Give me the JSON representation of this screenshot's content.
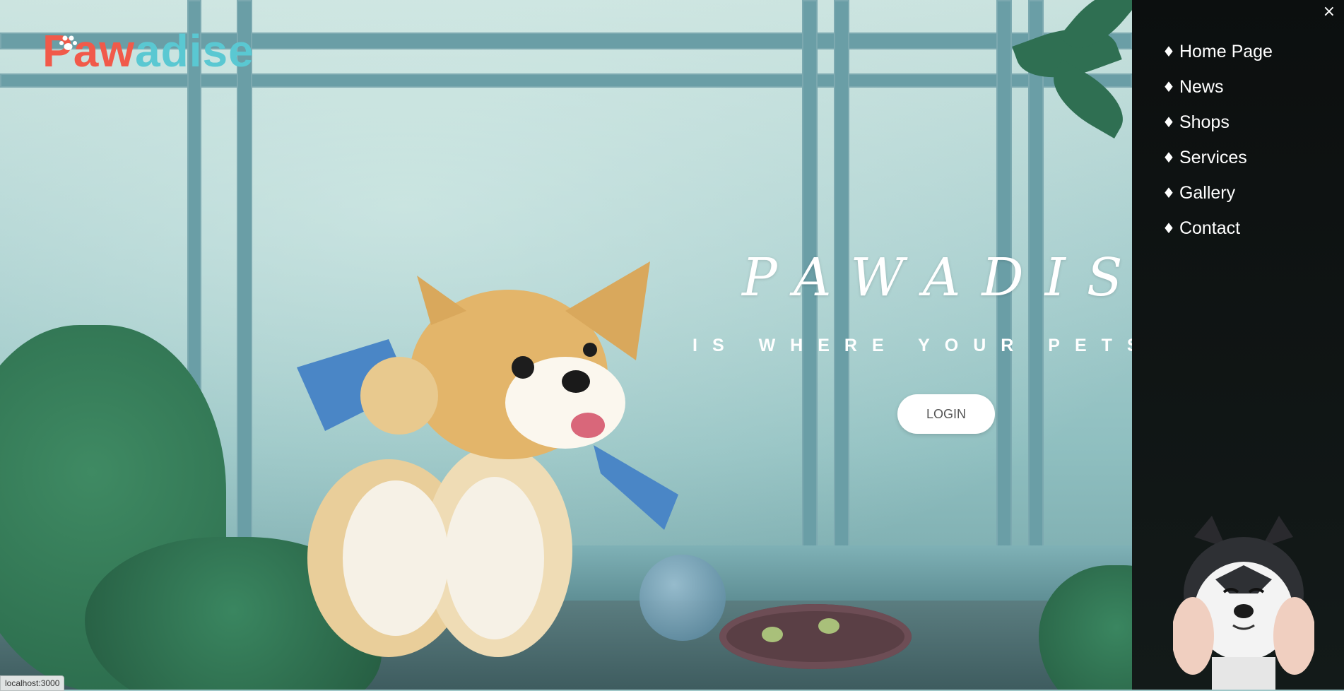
{
  "brand": {
    "logo_part1": "Paw",
    "logo_part2": "adise"
  },
  "hero": {
    "title": "PAWADISE",
    "subtitle": "IS WHERE YOUR PETS SMILE",
    "login_label": "LOGIN"
  },
  "side_menu": {
    "close_glyph": "×",
    "bullet": "♦",
    "items": [
      {
        "label": "Home Page"
      },
      {
        "label": "News"
      },
      {
        "label": "Shops"
      },
      {
        "label": "Services"
      },
      {
        "label": "Gallery"
      },
      {
        "label": "Contact"
      }
    ]
  },
  "status_bar": {
    "url": "localhost:3000"
  },
  "colors": {
    "logo_red": "#f15a4a",
    "logo_teal": "#5ac8d2",
    "panel_bg": "#0c0f0f",
    "button_bg": "#ffffff"
  },
  "icons": [
    "close-icon",
    "paw-icon",
    "hamburger-icon",
    "diamond-bullet-icon"
  ]
}
